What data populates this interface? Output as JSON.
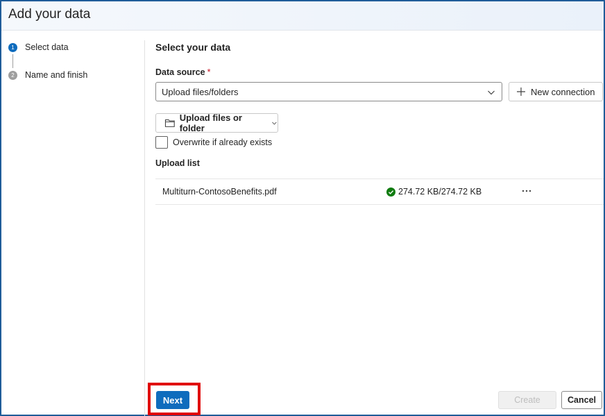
{
  "dialog": {
    "title": "Add your data"
  },
  "steps": [
    {
      "num": "1",
      "label": "Select data",
      "active": true
    },
    {
      "num": "2",
      "label": "Name and finish",
      "active": false
    }
  ],
  "main": {
    "section_title": "Select your data",
    "data_source": {
      "label": "Data source",
      "required_marker": "*",
      "selected_value": "Upload files/folders"
    },
    "new_connection_label": "New connection",
    "upload_button_label": "Upload files or folder",
    "overwrite_label": "Overwrite if already exists",
    "upload_list_label": "Upload list",
    "files": [
      {
        "name": "Multiturn-ContosoBenefits.pdf",
        "status": "274.72 KB/274.72 KB"
      }
    ]
  },
  "footer": {
    "next_label": "Next",
    "create_label": "Create",
    "cancel_label": "Cancel"
  },
  "colors": {
    "accent": "#0f6cbd",
    "success": "#107c10",
    "highlight": "#e00000",
    "frame": "#1f5c99"
  },
  "icons": {
    "chevron": "chevron-down-icon",
    "plus": "plus-icon",
    "folder": "folder-icon",
    "check": "success-check-icon",
    "more": "more-icon"
  }
}
